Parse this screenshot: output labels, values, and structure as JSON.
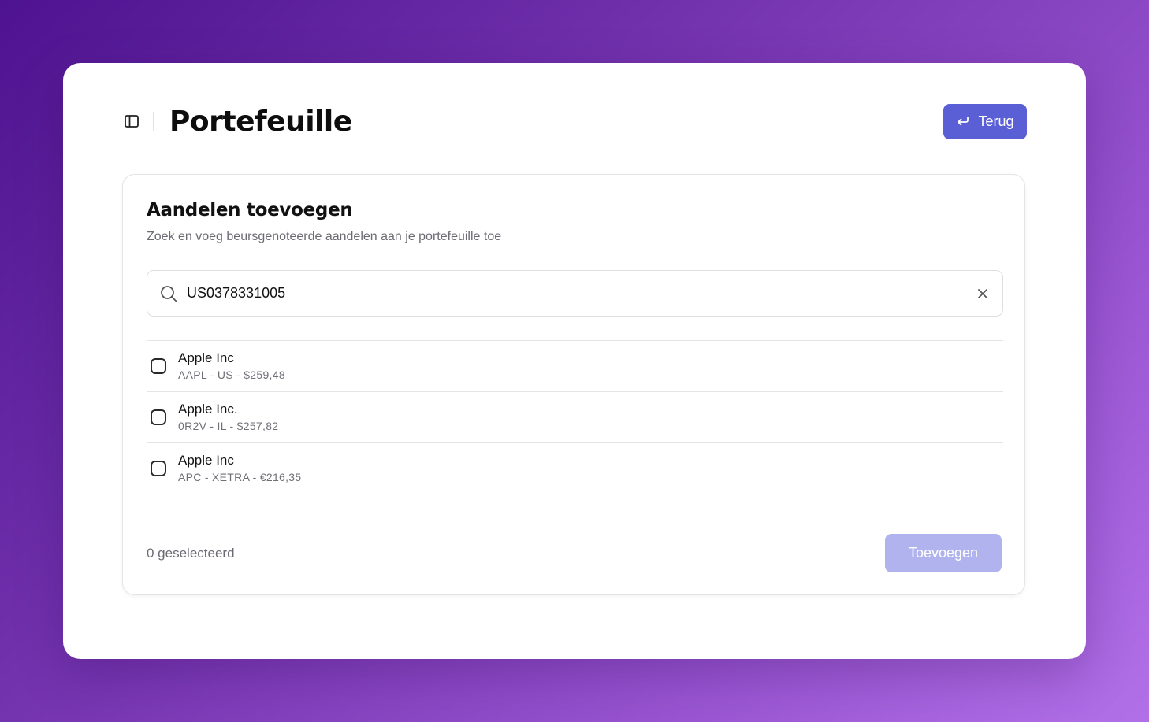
{
  "header": {
    "title": "Portefeuille",
    "back_label": "Terug"
  },
  "card": {
    "title": "Aandelen toevoegen",
    "subtitle": "Zoek en voeg beursgenoteerde aandelen aan je portefeuille toe"
  },
  "search": {
    "value": "US0378331005"
  },
  "results": [
    {
      "name": "Apple Inc",
      "meta": "AAPL - US - $259,48",
      "checked": false
    },
    {
      "name": "Apple Inc.",
      "meta": "0R2V - IL - $257,82",
      "checked": false
    },
    {
      "name": "Apple Inc",
      "meta": "APC - XETRA - €216,35",
      "checked": false
    }
  ],
  "footer": {
    "selected_label": "0 geselecteerd",
    "add_label": "Toevoegen"
  },
  "icons": {
    "sidebar": "sidebar-toggle-icon",
    "back": "return-arrow-icon",
    "search": "search-icon",
    "clear": "close-icon"
  },
  "colors": {
    "accent": "#5a5fd6",
    "accent_disabled": "#b1b3ee"
  }
}
